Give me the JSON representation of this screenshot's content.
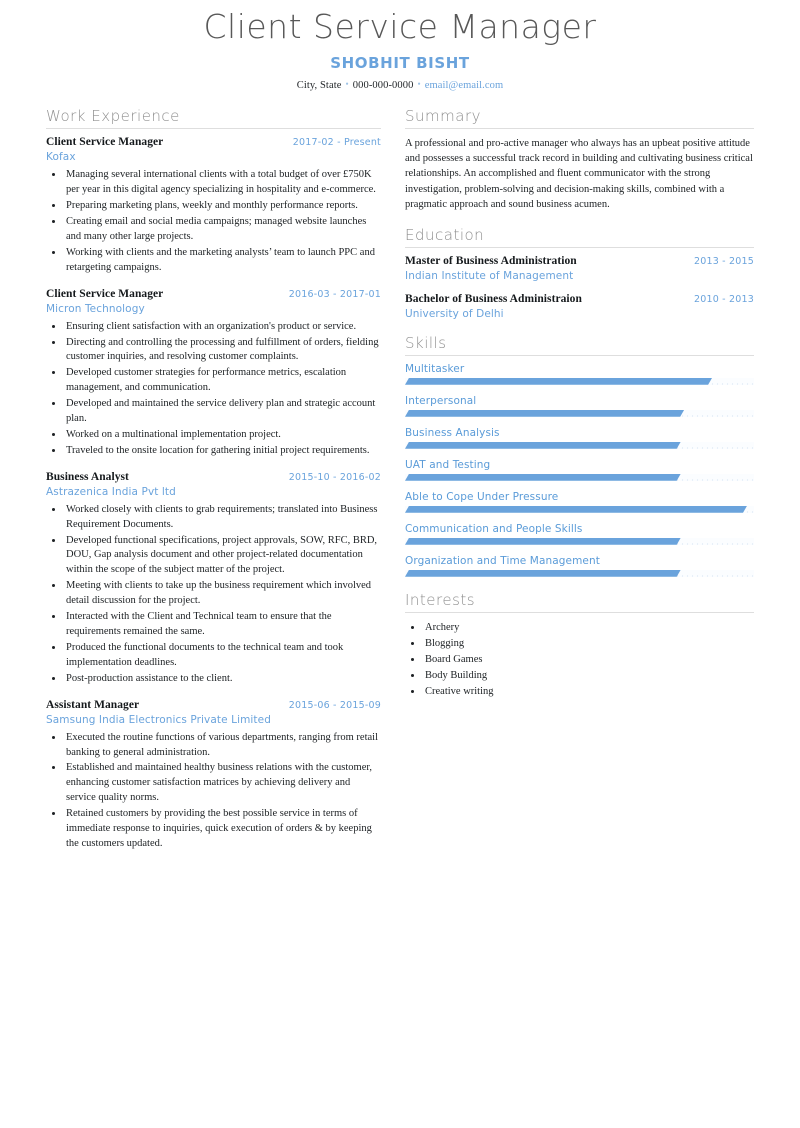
{
  "header": {
    "title": "Client Service Manager",
    "name": "SHOBHIT BISHT",
    "location": "City, State",
    "phone": "000-000-0000",
    "email": "email@email.com",
    "separator": "•"
  },
  "colors": {
    "accent_blue": "#6aa3dc",
    "skill_blue": "#5a9bd8",
    "section_gray": "#8f8f8f",
    "title_gray": "#585858",
    "rule_gray": "#dedede",
    "body_text": "#1d2124"
  },
  "left": {
    "work": {
      "title": "Work Experience",
      "entries": [
        {
          "role": "Client Service Manager",
          "date": "2017-02 - Present",
          "company": "Kofax",
          "bullets": [
            "Managing several international clients with a total budget of over £750K per year in this digital agency specializing in hospitality and e-commerce.",
            "Preparing marketing plans, weekly and monthly performance reports.",
            "Creating email and social media campaigns; managed website launches and many other large projects.",
            "Working with clients and the marketing analysts’ team to launch PPC and retargeting campaigns."
          ]
        },
        {
          "role": "Client Service Manager",
          "date": "2016-03 - 2017-01",
          "company": "Micron Technology",
          "bullets": [
            "Ensuring client satisfaction with an organization's product or service.",
            "Directing and controlling the processing and fulfillment of orders, fielding customer inquiries, and resolving customer complaints.",
            "Developed customer strategies for performance metrics, escalation management, and communication.",
            "Developed and maintained the service delivery plan and strategic account plan.",
            "Worked on a multinational implementation project.",
            "Traveled to the onsite location for gathering initial project requirements."
          ]
        },
        {
          "role": "Business Analyst",
          "date": "2015-10 - 2016-02",
          "company": "Astrazenica India Pvt ltd",
          "bullets": [
            "Worked closely with clients to grab requirements; translated into Business Requirement Documents.",
            "Developed functional specifications, project approvals, SOW, RFC, BRD, DOU, Gap analysis document and other project-related documentation within the scope of the subject matter of the project.",
            "Meeting with clients to take up the business requirement which involved detail discussion for the project.",
            "Interacted with the Client and Technical team to ensure that the requirements remained the same.",
            "Produced the functional documents to the technical team and took implementation deadlines.",
            "Post-production assistance to the client."
          ]
        },
        {
          "role": "Assistant Manager",
          "date": "2015-06 - 2015-09",
          "company": "Samsung India Electronics Private Limited",
          "bullets": [
            "Executed the routine functions of various departments, ranging from retail banking to general administration.",
            "Established and maintained healthy business relations with the customer, enhancing customer satisfaction matrices by achieving delivery and service quality norms.",
            "Retained customers by providing the best possible service in terms of immediate response to inquiries, quick execution of orders & by keeping the customers updated."
          ]
        }
      ]
    }
  },
  "right": {
    "summary": {
      "title": "Summary",
      "text": "A professional and pro-active manager who always has an upbeat positive attitude and possesses a successful track record in building and cultivating business critical relationships. An accomplished and fluent communicator with the strong investigation, problem-solving and decision-making skills, combined with a pragmatic approach and sound business acumen."
    },
    "education": {
      "title": "Education",
      "entries": [
        {
          "degree": "Master of Business Administration",
          "date": "2013 - 2015",
          "school": "Indian Institute of Management"
        },
        {
          "degree": "Bachelor of Business Administraion",
          "date": "2010 - 2013",
          "school": "University of Delhi"
        }
      ]
    },
    "skills": {
      "title": "Skills",
      "items": [
        {
          "label": "Multitasker",
          "level": 88
        },
        {
          "label": "Interpersonal",
          "level": 80
        },
        {
          "label": "Business Analysis",
          "level": 79
        },
        {
          "label": "UAT and Testing",
          "level": 79
        },
        {
          "label": "Able to Cope Under Pressure",
          "level": 98
        },
        {
          "label": "Communication and People Skills",
          "level": 79
        },
        {
          "label": "Organization and Time Management",
          "level": 79
        }
      ]
    },
    "interests": {
      "title": "Interests",
      "items": [
        "Archery",
        "Blogging",
        "Board Games",
        "Body Building",
        "Creative writing"
      ]
    }
  }
}
